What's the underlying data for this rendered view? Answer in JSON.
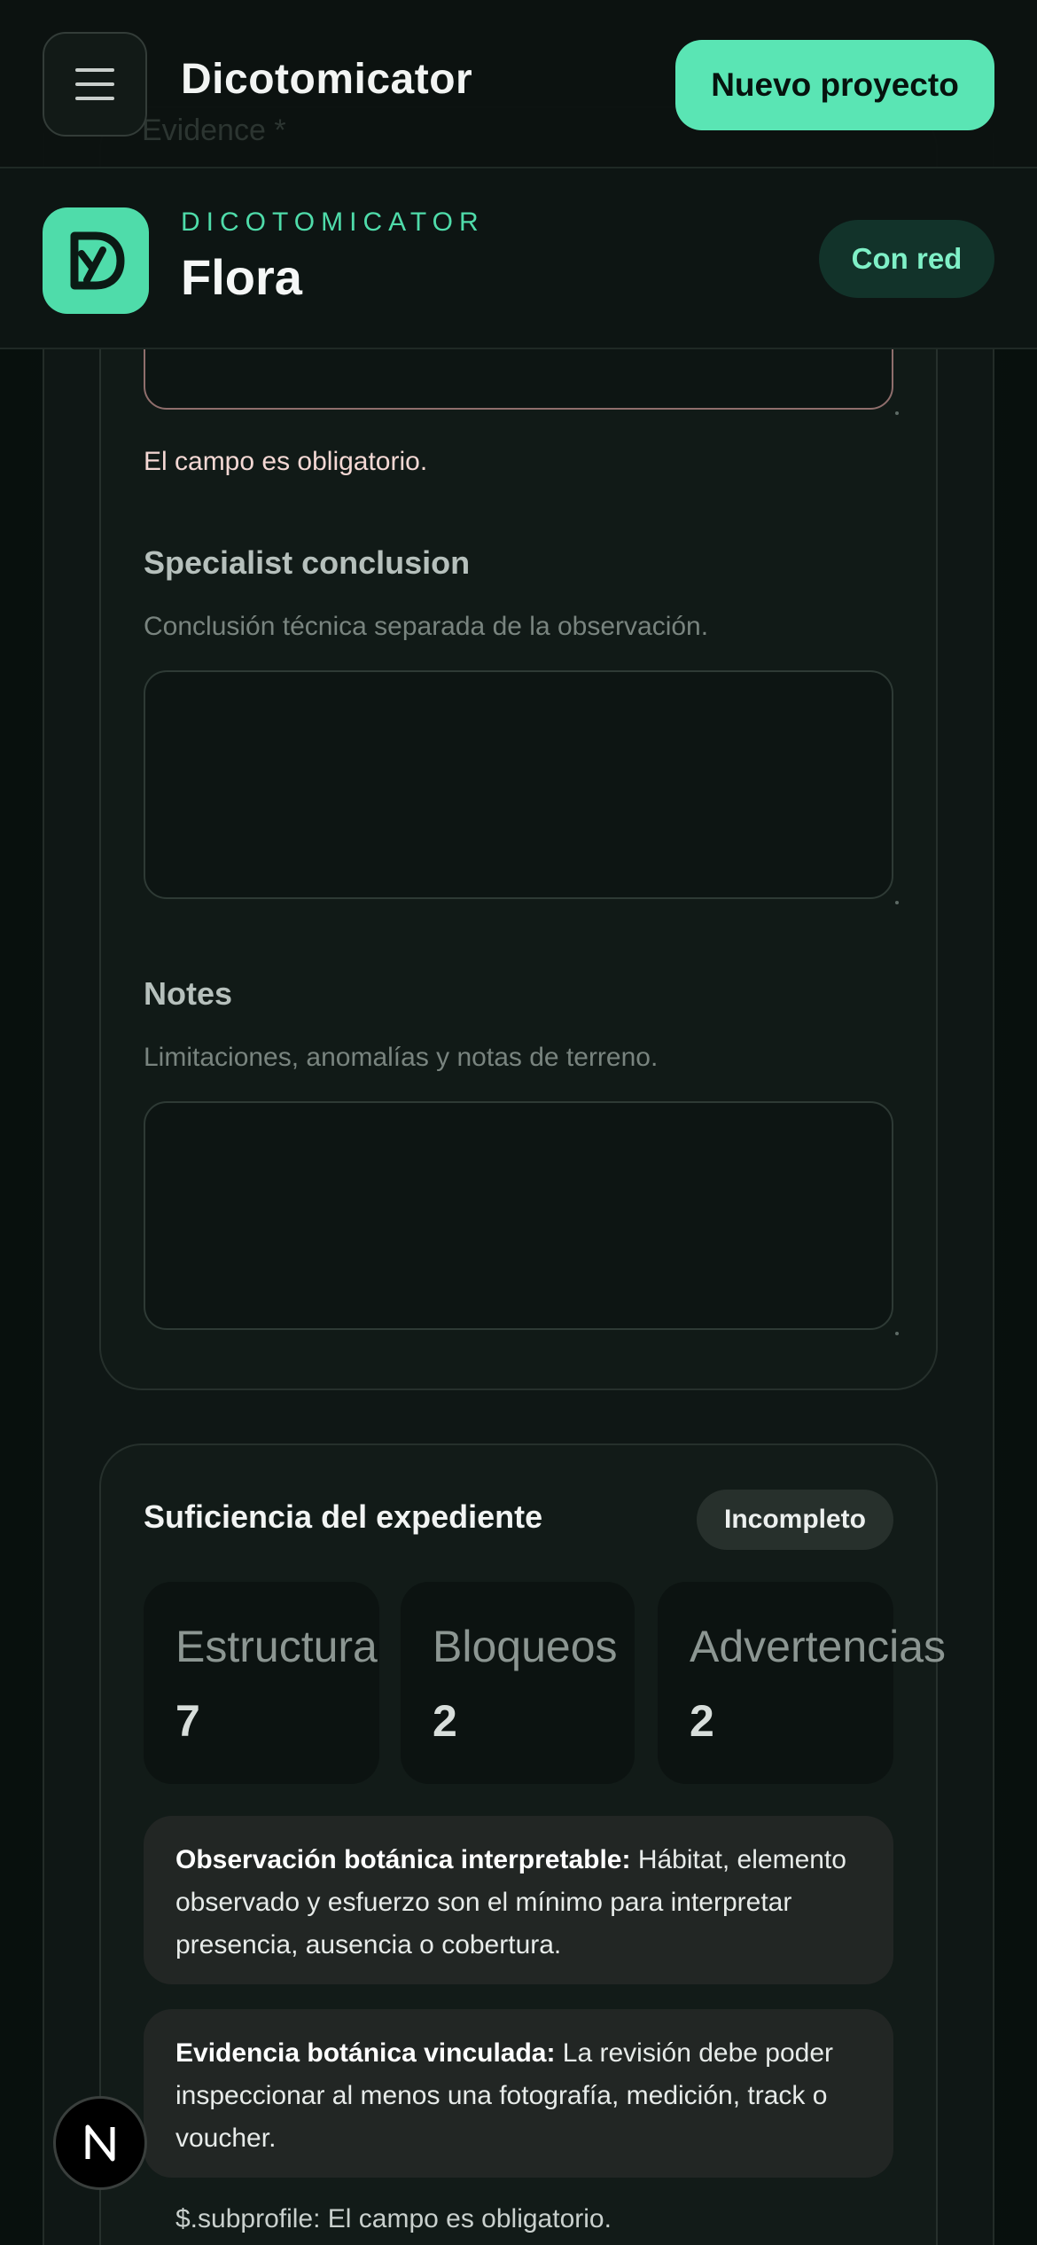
{
  "app": {
    "title": "Dicotomicator",
    "new_project_label": "Nuevo proyecto",
    "scrolled_ghost_text": "Evidence *"
  },
  "project": {
    "kicker": "DICOTOMICATOR",
    "name": "Flora",
    "network_status": "Con red"
  },
  "form": {
    "error_message": "El campo es obligatorio.",
    "fields": [
      {
        "label": "Specialist conclusion",
        "help": "Conclusión técnica separada de la observación.",
        "value": ""
      },
      {
        "label": "Notes",
        "help": "Limitaciones, anomalías y notas de terreno.",
        "value": ""
      }
    ]
  },
  "sufficiency": {
    "title": "Suficiencia del expediente",
    "status": "Incompleto",
    "stats": [
      {
        "label": "Estructura",
        "value": "7"
      },
      {
        "label": "Bloqueos",
        "value": "2"
      },
      {
        "label": "Advertencias",
        "value": "2"
      }
    ],
    "requirements": [
      {
        "title": "Observación botánica interpretable:",
        "text": " Hábitat, elemento observado y esfuerzo son el mínimo para interpretar presencia, ausencia o cobertura."
      },
      {
        "title": "Evidencia botánica vinculada:",
        "text": " La revisión debe poder inspeccionar al menos una fotografía, medición, track o voucher."
      }
    ],
    "issue": "$.subprofile: El campo es obligatorio."
  },
  "dev_badge": {
    "letter": "N"
  },
  "colors": {
    "accent": "#5ae5b4",
    "background": "#0b1210",
    "card": "#111a17",
    "error_border": "#8f6e6c"
  }
}
